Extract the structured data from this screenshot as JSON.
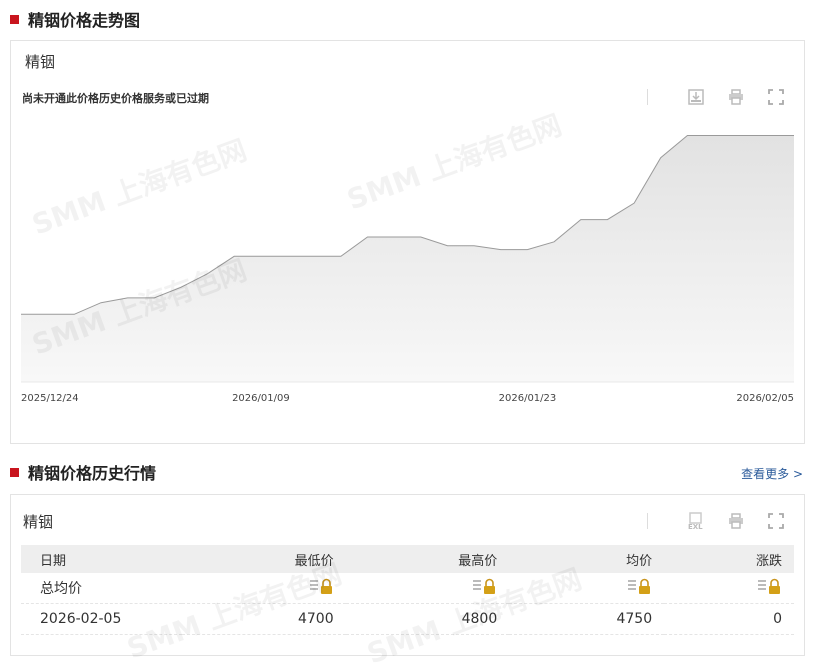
{
  "trend_section": {
    "heading": "精铟价格走势图",
    "panel_title": "精铟",
    "notice": "尚未开通此价格历史价格服务或已过期",
    "toolbar": {
      "download_icon": "download-image-icon",
      "print_icon": "print-icon",
      "fullscreen_icon": "fullscreen-icon"
    }
  },
  "watermark": {
    "logo": "SMM",
    "text": "上海有色网"
  },
  "chart_data": {
    "type": "area",
    "x_tick_labels": [
      "2025/12/24",
      "2026/01/09",
      "2026/01/23",
      "2026/02/05"
    ],
    "y_axis_visible": false,
    "grid": false,
    "legend": "none",
    "values": [
      2900,
      2900,
      2900,
      3020,
      3070,
      3070,
      3180,
      3320,
      3500,
      3500,
      3500,
      3500,
      3500,
      3700,
      3700,
      3700,
      3610,
      3610,
      3570,
      3570,
      3650,
      3880,
      3880,
      4050,
      4520,
      4750,
      4750,
      4750,
      4750,
      4750
    ],
    "ylim": [
      2200,
      4900
    ],
    "colors": {
      "line": "#9a9a9a",
      "fill_top": "#e2e2e2",
      "fill_bottom": "#f8f8f8"
    }
  },
  "history_section": {
    "heading": "精铟价格历史行情",
    "more_link": "查看更多 >",
    "panel_title": "精铟",
    "toolbar": {
      "excel_icon": "excel-export-icon",
      "print_icon": "print-icon",
      "fullscreen_icon": "fullscreen-icon"
    },
    "columns": [
      "日期",
      "最低价",
      "最高价",
      "均价",
      "涨跌"
    ],
    "summary_row": {
      "label": "总均价",
      "locked_icon": "locked-data-icon"
    },
    "rows": [
      {
        "date": "2026-02-05",
        "low": "4700",
        "high": "4800",
        "avg": "4750",
        "change": "0"
      }
    ]
  }
}
